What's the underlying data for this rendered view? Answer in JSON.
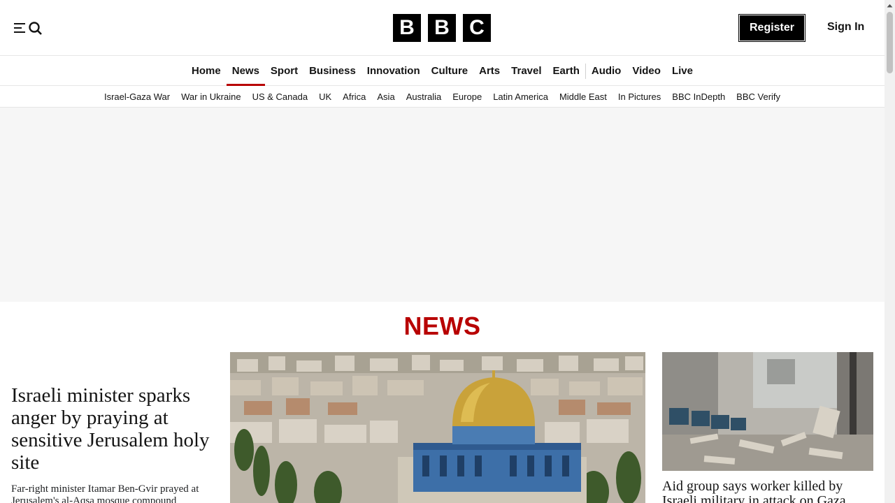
{
  "header": {
    "logo_letters": [
      "B",
      "B",
      "C"
    ],
    "register_label": "Register",
    "signin_label": "Sign In",
    "menu_icon": "menu-icon",
    "search_icon": "search-icon"
  },
  "primary_nav": {
    "items": [
      {
        "label": "Home",
        "active": false
      },
      {
        "label": "News",
        "active": true
      },
      {
        "label": "Sport",
        "active": false
      },
      {
        "label": "Business",
        "active": false
      },
      {
        "label": "Innovation",
        "active": false
      },
      {
        "label": "Culture",
        "active": false
      },
      {
        "label": "Arts",
        "active": false
      },
      {
        "label": "Travel",
        "active": false
      },
      {
        "label": "Earth",
        "active": false
      },
      {
        "label": "Audio",
        "active": false
      },
      {
        "label": "Video",
        "active": false
      },
      {
        "label": "Live",
        "active": false
      }
    ]
  },
  "secondary_nav": {
    "items": [
      "Israel-Gaza War",
      "War in Ukraine",
      "US & Canada",
      "UK",
      "Africa",
      "Asia",
      "Australia",
      "Europe",
      "Latin America",
      "Middle East",
      "In Pictures",
      "BBC InDepth",
      "BBC Verify"
    ]
  },
  "section": {
    "title": "NEWS"
  },
  "stories": {
    "lead": {
      "headline": "Israeli minister sparks anger by praying at sensitive Jerusalem holy site",
      "summary": "Far-right minister Itamar Ben-Gvir prayed at Jerusalem's al-Aqsa mosque compound"
    },
    "right": {
      "headline": "Aid group says worker killed by Israeli military in attack on Gaza"
    }
  },
  "colors": {
    "brand": "#000000",
    "accent": "#b80000",
    "text": "#141414"
  }
}
